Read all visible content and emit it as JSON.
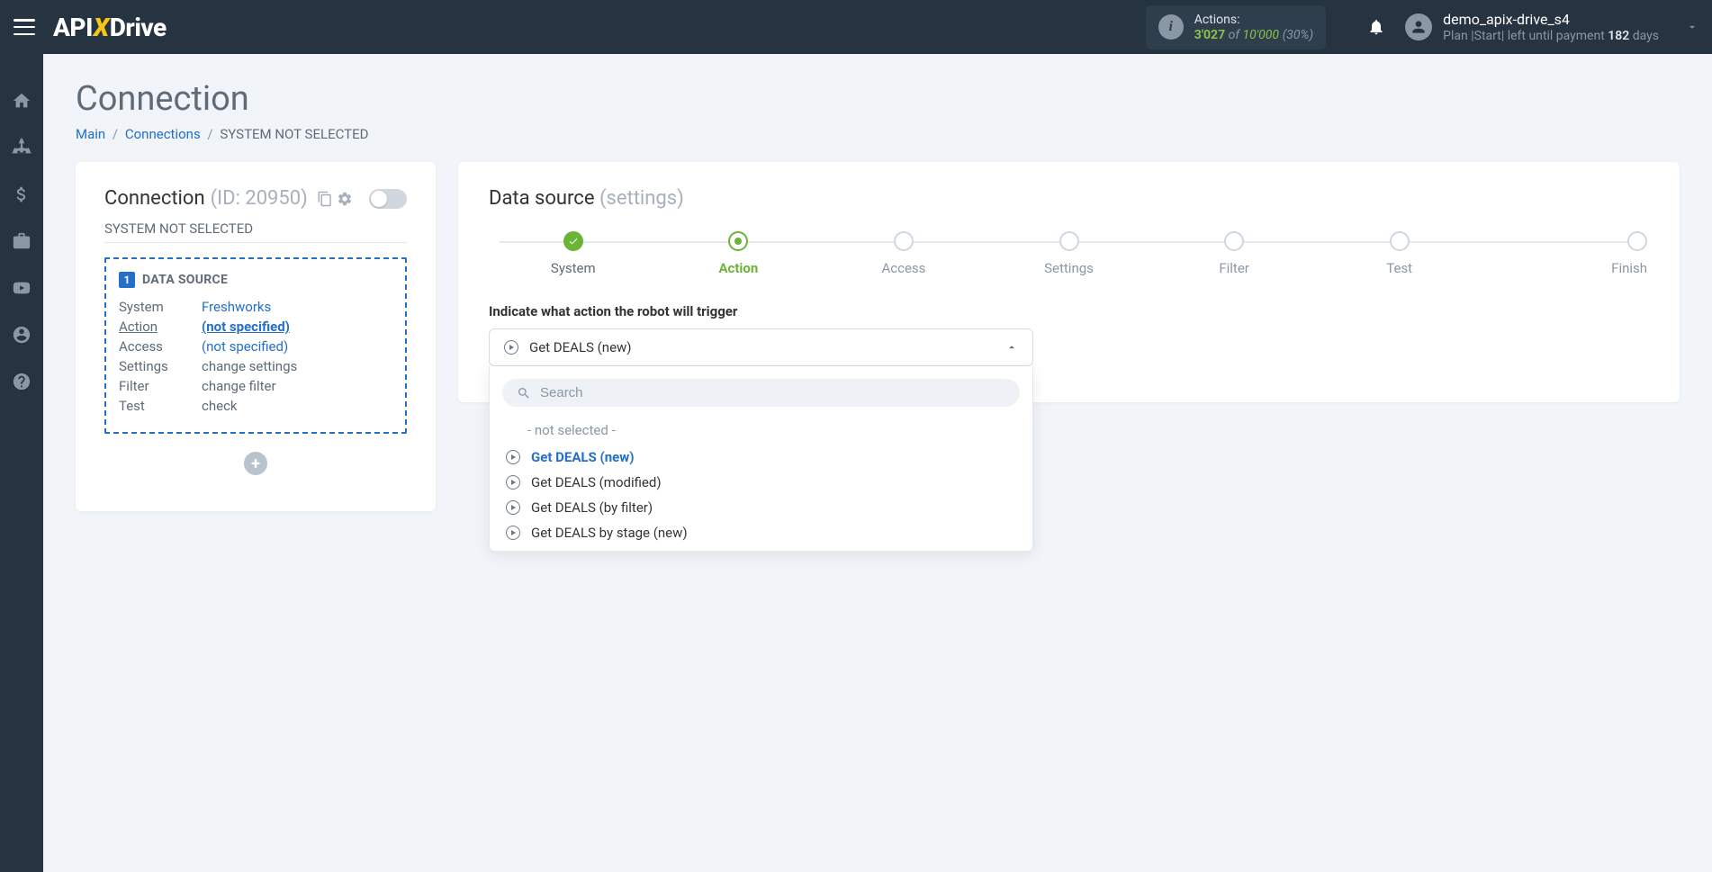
{
  "header": {
    "logo_pre": "API",
    "logo_x": "X",
    "logo_post": "Drive",
    "actions_label": "Actions:",
    "used": "3'027",
    "of": "of",
    "total": "10'000",
    "pct": "(30%)",
    "username": "demo_apix-drive_s4",
    "plan_pre": "Plan |",
    "plan_name": "Start",
    "plan_mid": "| left until payment ",
    "plan_days": "182",
    "plan_suffix": " days"
  },
  "page": {
    "title": "Connection",
    "breadcrumb": {
      "main": "Main",
      "connections": "Connections",
      "current": "SYSTEM NOT SELECTED"
    }
  },
  "left": {
    "title": "Connection ",
    "id": "(ID: 20950)",
    "system_label": "SYSTEM NOT SELECTED",
    "ds_title": "DATA SOURCE",
    "rows": {
      "system_k": "System",
      "system_v": "Freshworks",
      "action_k": "Action",
      "action_v": "(not specified)",
      "access_k": "Access",
      "access_v": "(not specified)",
      "settings_k": "Settings",
      "settings_v": "change settings",
      "filter_k": "Filter",
      "filter_v": "change filter",
      "test_k": "Test",
      "test_v": "check"
    }
  },
  "right": {
    "title": "Data source ",
    "subtitle": "(settings)",
    "steps": {
      "s1": "System",
      "s2": "Action",
      "s3": "Access",
      "s4": "Settings",
      "s5": "Filter",
      "s6": "Test",
      "s7": "Finish"
    },
    "field_label": "Indicate what action the robot will trigger",
    "selected": "Get DEALS (new)",
    "search_placeholder": "Search",
    "not_selected": "- not selected -",
    "options": {
      "o1": "Get DEALS (new)",
      "o2": "Get DEALS (modified)",
      "o3": "Get DEALS (by filter)",
      "o4": "Get DEALS by stage (new)"
    }
  }
}
